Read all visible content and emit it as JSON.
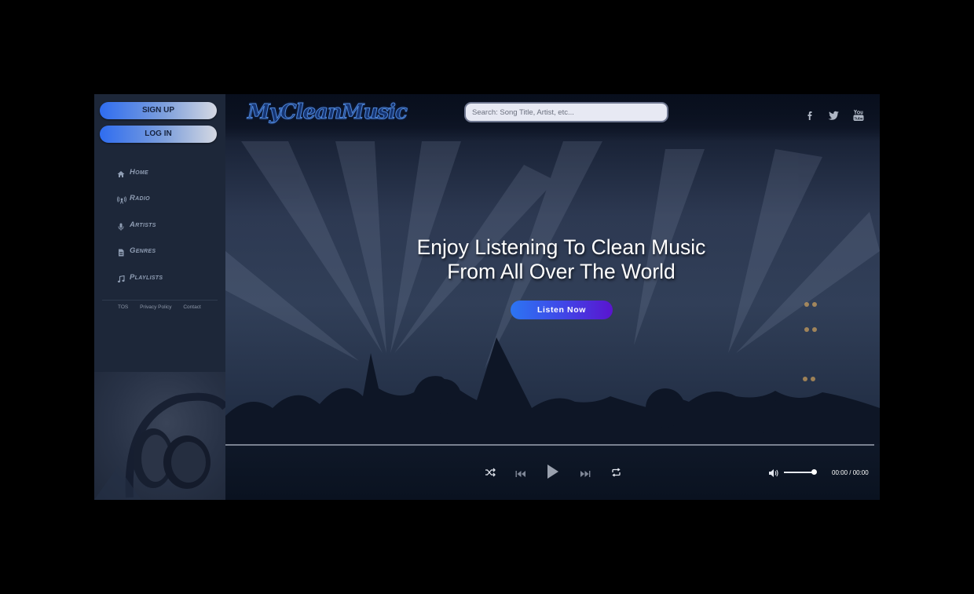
{
  "sidebar": {
    "signup_label": "SIGN UP",
    "login_label": "LOG IN",
    "nav": [
      {
        "label": "Home",
        "icon": "home-icon"
      },
      {
        "label": "Radio",
        "icon": "radio-icon"
      },
      {
        "label": "Artists",
        "icon": "microphone-icon"
      },
      {
        "label": "Genres",
        "icon": "document-icon"
      },
      {
        "label": "Playlists",
        "icon": "music-note-icon"
      }
    ],
    "footer": {
      "tos": "TOS",
      "privacy": "Privacy Policy",
      "contact": "Contact"
    }
  },
  "header": {
    "logo": "MyCleanMusic",
    "search_placeholder": "Search: Song Title, Artist, etc...",
    "social": [
      "facebook-icon",
      "twitter-icon",
      "youtube-icon"
    ]
  },
  "hero": {
    "line1": "Enjoy Listening To Clean Music",
    "line2": "From All Over The World",
    "cta_label": "Listen Now"
  },
  "player": {
    "time": "00:00 / 00:00",
    "progress": 0,
    "volume": 1.0
  },
  "colors": {
    "accent_blue": "#2f6df0",
    "accent_purple": "#5a14cf",
    "sidebar_bg": "#1d2739"
  }
}
